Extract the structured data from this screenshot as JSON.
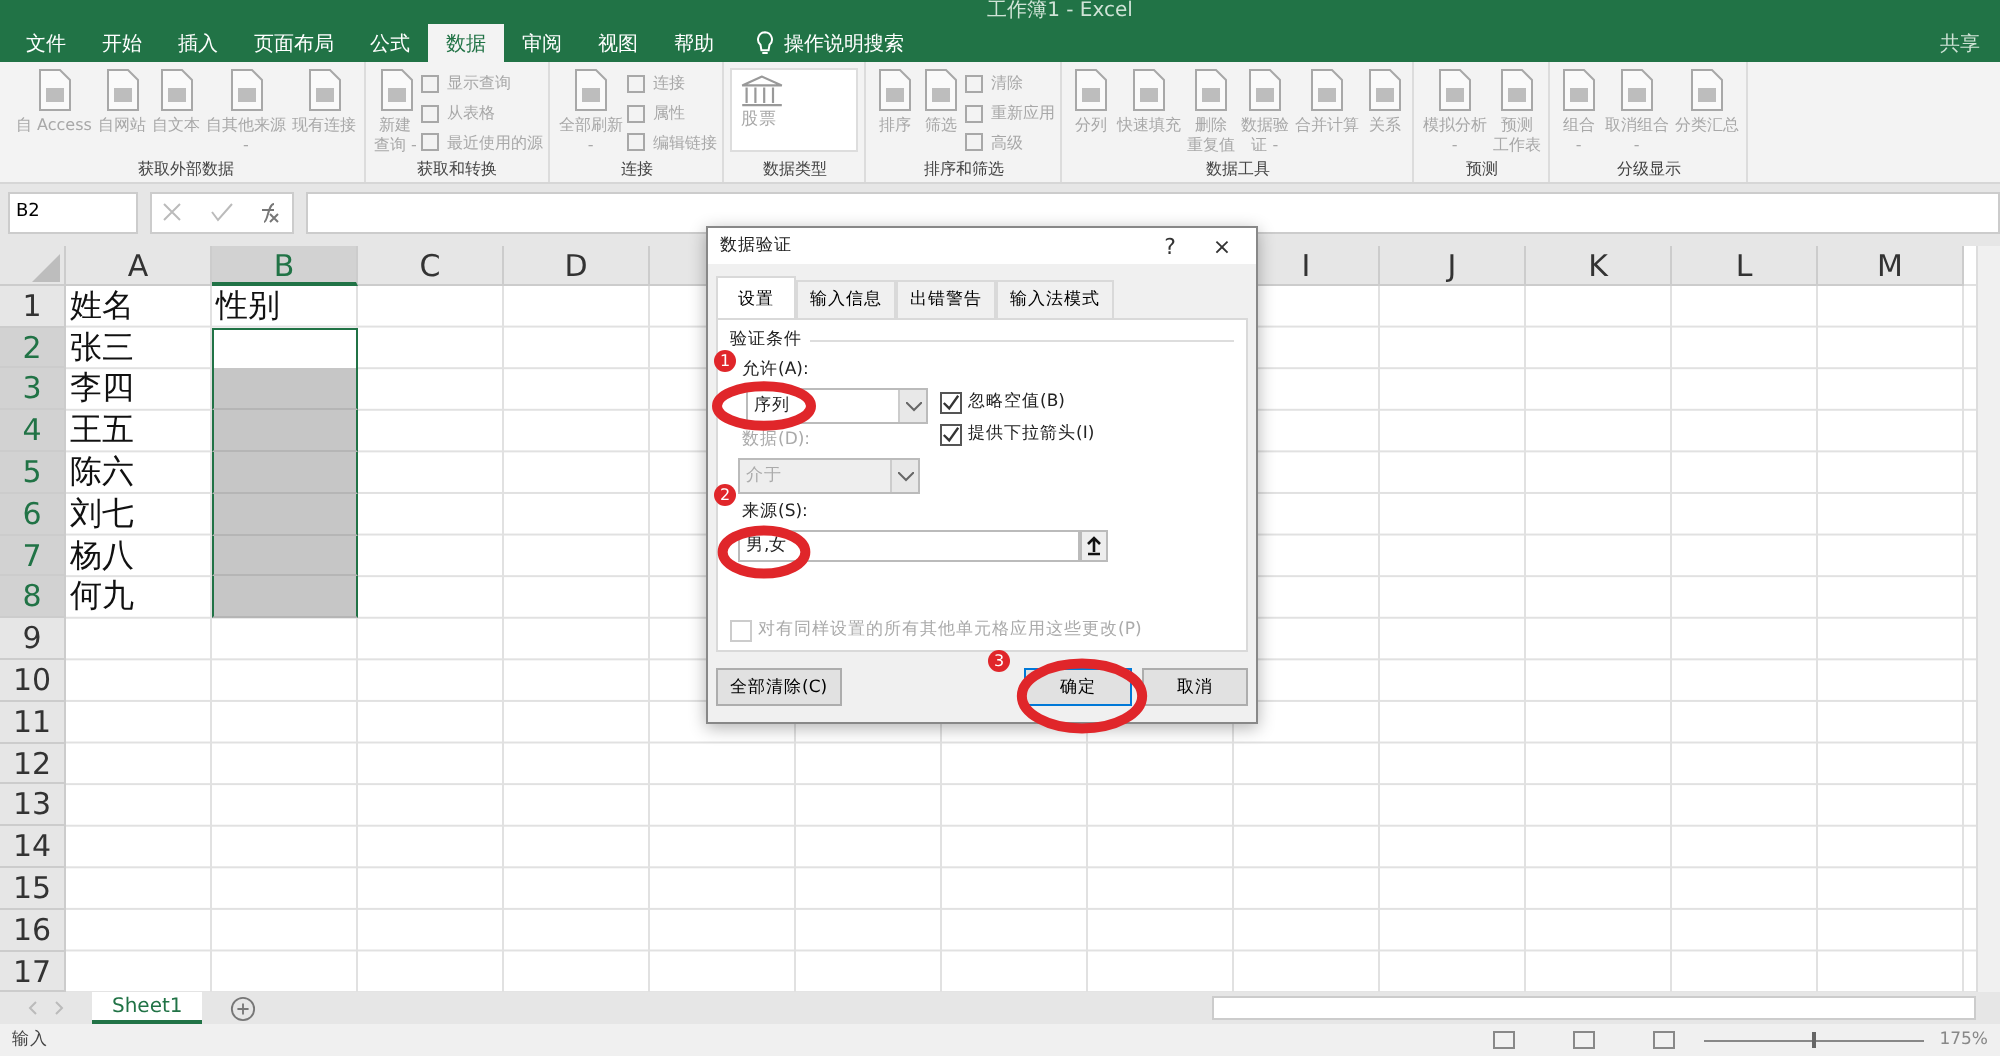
{
  "window": {
    "title": "工作簿1 - Excel",
    "share": "共享"
  },
  "menu_tabs": [
    {
      "label": "文件",
      "selected": false
    },
    {
      "label": "开始",
      "selected": false
    },
    {
      "label": "插入",
      "selected": false
    },
    {
      "label": "页面布局",
      "selected": false
    },
    {
      "label": "公式",
      "selected": false
    },
    {
      "label": "数据",
      "selected": true
    },
    {
      "label": "审阅",
      "selected": false
    },
    {
      "label": "视图",
      "selected": false
    },
    {
      "label": "帮助",
      "selected": false
    }
  ],
  "tell_me": "操作说明搜索",
  "ribbon_groups": [
    {
      "label": "获取外部数据",
      "items": [
        {
          "kind": "big",
          "lines": [
            "自 Access"
          ]
        },
        {
          "kind": "big",
          "lines": [
            "自网站"
          ]
        },
        {
          "kind": "big",
          "lines": [
            "自文本"
          ]
        },
        {
          "kind": "big",
          "lines": [
            "自其他来源",
            "-"
          ]
        },
        {
          "kind": "big",
          "lines": [
            "现有连接"
          ]
        }
      ]
    },
    {
      "label": "获取和转换",
      "items": [
        {
          "kind": "big",
          "lines": [
            "新建",
            "查询 -"
          ]
        },
        {
          "kind": "stack",
          "lines": [
            "显示查询",
            "从表格",
            "最近使用的源"
          ]
        }
      ]
    },
    {
      "label": "连接",
      "items": [
        {
          "kind": "big",
          "lines": [
            "全部刷新",
            "-"
          ]
        },
        {
          "kind": "stack",
          "lines": [
            "连接",
            "属性",
            "编辑链接"
          ]
        }
      ]
    },
    {
      "label": "数据类型",
      "items": [
        {
          "kind": "gallery",
          "lines": [
            "股票"
          ]
        }
      ]
    },
    {
      "label": "排序和筛选",
      "items": [
        {
          "kind": "big",
          "lines": [
            "排序"
          ]
        },
        {
          "kind": "big",
          "lines": [
            "筛选"
          ]
        },
        {
          "kind": "stack",
          "lines": [
            "清除",
            "重新应用",
            "高级"
          ]
        }
      ]
    },
    {
      "label": "数据工具",
      "items": [
        {
          "kind": "big",
          "lines": [
            "分列"
          ]
        },
        {
          "kind": "big",
          "lines": [
            "快速填充"
          ]
        },
        {
          "kind": "big",
          "lines": [
            "删除",
            "重复值"
          ]
        },
        {
          "kind": "big",
          "lines": [
            "数据验",
            "证 -"
          ]
        },
        {
          "kind": "big",
          "lines": [
            "合并计算"
          ]
        },
        {
          "kind": "big",
          "lines": [
            "关系"
          ]
        }
      ]
    },
    {
      "label": "预测",
      "items": [
        {
          "kind": "big",
          "lines": [
            "模拟分析",
            "-"
          ]
        },
        {
          "kind": "big",
          "lines": [
            "预测",
            "工作表"
          ]
        }
      ]
    },
    {
      "label": "分级显示",
      "items": [
        {
          "kind": "big",
          "lines": [
            "组合",
            "-"
          ]
        },
        {
          "kind": "big",
          "lines": [
            "取消组合",
            "-"
          ]
        },
        {
          "kind": "big",
          "lines": [
            "分类汇总"
          ]
        }
      ]
    }
  ],
  "name_box": "B2",
  "columns": [
    {
      "label": "A",
      "selected": false
    },
    {
      "label": "B",
      "selected": true
    },
    {
      "label": "C",
      "selected": false
    },
    {
      "label": "D",
      "selected": false
    },
    {},
    {},
    {},
    {},
    {
      "label": "I",
      "selected": false
    },
    {
      "label": "J",
      "selected": false
    },
    {
      "label": "K",
      "selected": false
    },
    {
      "label": "L",
      "selected": false
    },
    {
      "label": "M",
      "selected": false
    }
  ],
  "rows": [
    {
      "number": "1",
      "selected": false,
      "cells": [
        "姓名",
        "性别"
      ]
    },
    {
      "number": "2",
      "selected": true,
      "cells": [
        "张三"
      ]
    },
    {
      "number": "3",
      "selected": true,
      "cells": [
        "李四"
      ]
    },
    {
      "number": "4",
      "selected": true,
      "cells": [
        "王五"
      ]
    },
    {
      "number": "5",
      "selected": true,
      "cells": [
        "陈六"
      ]
    },
    {
      "number": "6",
      "selected": true,
      "cells": [
        "刘七"
      ]
    },
    {
      "number": "7",
      "selected": true,
      "cells": [
        "杨八"
      ]
    },
    {
      "number": "8",
      "selected": true,
      "cells": [
        "何九"
      ]
    },
    {
      "number": "9",
      "selected": false,
      "cells": []
    },
    {
      "number": "10",
      "selected": false,
      "cells": []
    },
    {
      "number": "11",
      "selected": false,
      "cells": []
    },
    {
      "number": "12",
      "selected": false,
      "cells": []
    },
    {
      "number": "13",
      "selected": false,
      "cells": []
    },
    {
      "number": "14",
      "selected": false,
      "cells": []
    },
    {
      "number": "15",
      "selected": false,
      "cells": []
    },
    {
      "number": "16",
      "selected": false,
      "cells": []
    },
    {
      "number": "17",
      "selected": false,
      "cells": []
    }
  ],
  "sheets": [
    {
      "label": "Sheet1",
      "selected": true
    }
  ],
  "status": {
    "mode": "输入",
    "zoom": "175%",
    "zoom_slider": {
      "level": 0.5
    }
  },
  "dialog": {
    "title": "数据验证",
    "help": "?",
    "close": "×",
    "tabs": [
      {
        "label": "设置",
        "selected": true
      },
      {
        "label": "输入信息",
        "selected": false
      },
      {
        "label": "出错警告",
        "selected": false
      },
      {
        "label": "输入法模式",
        "selected": false
      }
    ],
    "section": "验证条件",
    "allow": {
      "label": "允许(A):",
      "value": "序列"
    },
    "data": {
      "label": "数据(D):",
      "value": "介于",
      "disabled": true
    },
    "checkboxes": [
      {
        "label": "忽略空值(B)",
        "checked": true
      },
      {
        "label": "提供下拉箭头(I)",
        "checked": true
      }
    ],
    "source": {
      "label": "来源(S):",
      "value": "男,女"
    },
    "apply_all": {
      "label": "对有同样设置的所有其他单元格应用这些更改(P)",
      "checked": false,
      "disabled": true
    },
    "buttons": [
      {
        "label": "全部清除(C)",
        "kind": "clear"
      },
      {
        "label": "确定",
        "kind": "ok"
      },
      {
        "label": "取消",
        "kind": "cancel"
      }
    ]
  },
  "annotations": [
    {
      "number": "1"
    },
    {
      "number": "2"
    },
    {
      "number": "3"
    }
  ]
}
